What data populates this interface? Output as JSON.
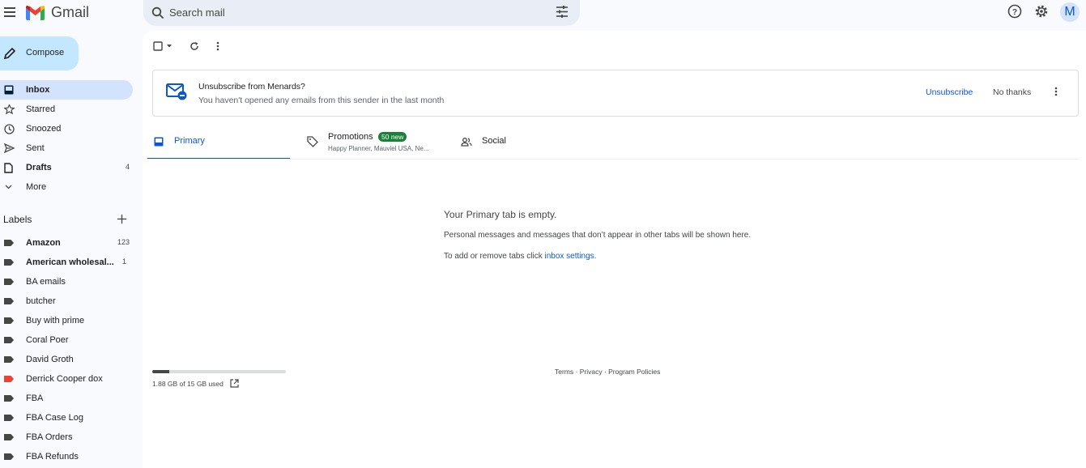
{
  "header": {
    "app_name": "Gmail",
    "search_placeholder": "Search mail",
    "avatar_initial": "M"
  },
  "compose": {
    "label": "Compose"
  },
  "nav": [
    {
      "label": "Inbox",
      "count": "",
      "bold": true,
      "active": true,
      "icon": "inbox-icon"
    },
    {
      "label": "Starred",
      "count": "",
      "icon": "star-icon"
    },
    {
      "label": "Snoozed",
      "count": "",
      "icon": "clock-icon"
    },
    {
      "label": "Sent",
      "count": "",
      "icon": "send-icon"
    },
    {
      "label": "Drafts",
      "count": "4",
      "bold": true,
      "icon": "file-icon"
    },
    {
      "label": "More",
      "count": "",
      "icon": "chevron-down-icon"
    }
  ],
  "labels": {
    "heading": "Labels",
    "items": [
      {
        "label": "Amazon",
        "count": "123",
        "bold": true,
        "color": "#444746"
      },
      {
        "label": "American wholesal...",
        "count": "1",
        "bold": true,
        "color": "#444746"
      },
      {
        "label": "BA emails",
        "count": "",
        "color": "#444746"
      },
      {
        "label": "butcher",
        "count": "",
        "color": "#444746"
      },
      {
        "label": "Buy with prime",
        "count": "",
        "color": "#444746"
      },
      {
        "label": "Coral Poer",
        "count": "",
        "color": "#444746"
      },
      {
        "label": "David Groth",
        "count": "",
        "color": "#444746"
      },
      {
        "label": "Derrick Cooper dox",
        "count": "",
        "color": "#ea4335"
      },
      {
        "label": "FBA",
        "count": "",
        "color": "#444746"
      },
      {
        "label": "FBA Case Log",
        "count": "",
        "color": "#444746"
      },
      {
        "label": "FBA Orders",
        "count": "",
        "color": "#444746"
      },
      {
        "label": "FBA Refunds",
        "count": "",
        "color": "#444746"
      }
    ]
  },
  "banner": {
    "title": "Unsubscribe from Menards?",
    "subtitle": "You haven't opened any emails from this sender in the last month",
    "unsubscribe": "Unsubscribe",
    "no_thanks": "No thanks"
  },
  "tabs": {
    "primary": "Primary",
    "promotions": "Promotions",
    "promotions_badge": "50 new",
    "promotions_sub": "Happy Planner, Mauviel USA, Ne...",
    "social": "Social"
  },
  "empty": {
    "title": "Your Primary tab is empty.",
    "line1": "Personal messages and messages that don’t appear in other tabs will be shown here.",
    "line2_prefix": "To add or remove tabs click ",
    "line2_link": "inbox settings",
    "line2_suffix": "."
  },
  "storage": {
    "text": "1.88 GB of 15 GB used",
    "fraction": 0.125
  },
  "footer": {
    "terms": "Terms",
    "sep": " · ",
    "privacy": "Privacy",
    "policies": "Program Policies"
  }
}
